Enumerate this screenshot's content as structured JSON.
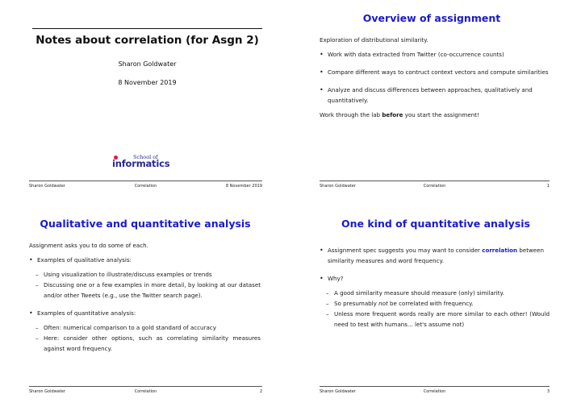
{
  "slides": [
    {
      "title": "Notes about correlation (for Asgn 2)",
      "author": "Sharon Goldwater",
      "date": "8 November 2019",
      "logo": {
        "small": "School of",
        "large": "informatics"
      },
      "footer": {
        "left": "Sharon Goldwater",
        "center": "Correlation",
        "right": "8 November 2019"
      }
    },
    {
      "title": "Overview of assignment",
      "intro": "Exploration of distributional similarity.",
      "bullets": [
        "Work with data extracted from Twitter (co-occurrence counts)",
        "Compare different ways to contruct context vectors and compute similarities",
        "Analyze and discuss differences between approaches, qualitatively and quantitatively."
      ],
      "closing": {
        "pre": "Work through the lab ",
        "bold": "before",
        "post": " you start the assignment!"
      },
      "footer": {
        "left": "Sharon Goldwater",
        "center": "Correlation",
        "right": "1"
      }
    },
    {
      "title": "Qualitative and quantitative analysis",
      "intro": "Assignment asks you to do some of each.",
      "groups": [
        {
          "bullet": "Examples of qualitative analysis:",
          "items": [
            "Using visualization to illustrate/discuss examples or trends",
            "Discussing one or a few examples in more detail, by looking at our dataset and/or other Tweets (e.g., use the Twitter search page)."
          ]
        },
        {
          "bullet": "Examples of quantitative analysis:",
          "items": [
            "Often: numerical comparison to a gold standard of accuracy",
            "Here:  consider other options, such as correlating similarity measures against word frequency."
          ]
        }
      ],
      "footer": {
        "left": "Sharon Goldwater",
        "center": "Correlation",
        "right": "2"
      }
    },
    {
      "title": "One kind of quantitative analysis",
      "bullet1": {
        "pre": "Assignment spec suggests you may want to consider ",
        "highlight": "correlation",
        "post": " between similarity measures and word frequency."
      },
      "bullet2": "Why?",
      "items": [
        {
          "text": "A good similarity measure should measure (only) similarity."
        },
        {
          "pre": "So presumably ",
          "italic": "not",
          "post": " be correlated with frequency."
        },
        {
          "text": "Unless more frequent words really are more similar to each other! (Would need to test with humans... let's assume not)"
        }
      ],
      "footer": {
        "left": "Sharon Goldwater",
        "center": "Correlation",
        "right": "3"
      }
    }
  ]
}
